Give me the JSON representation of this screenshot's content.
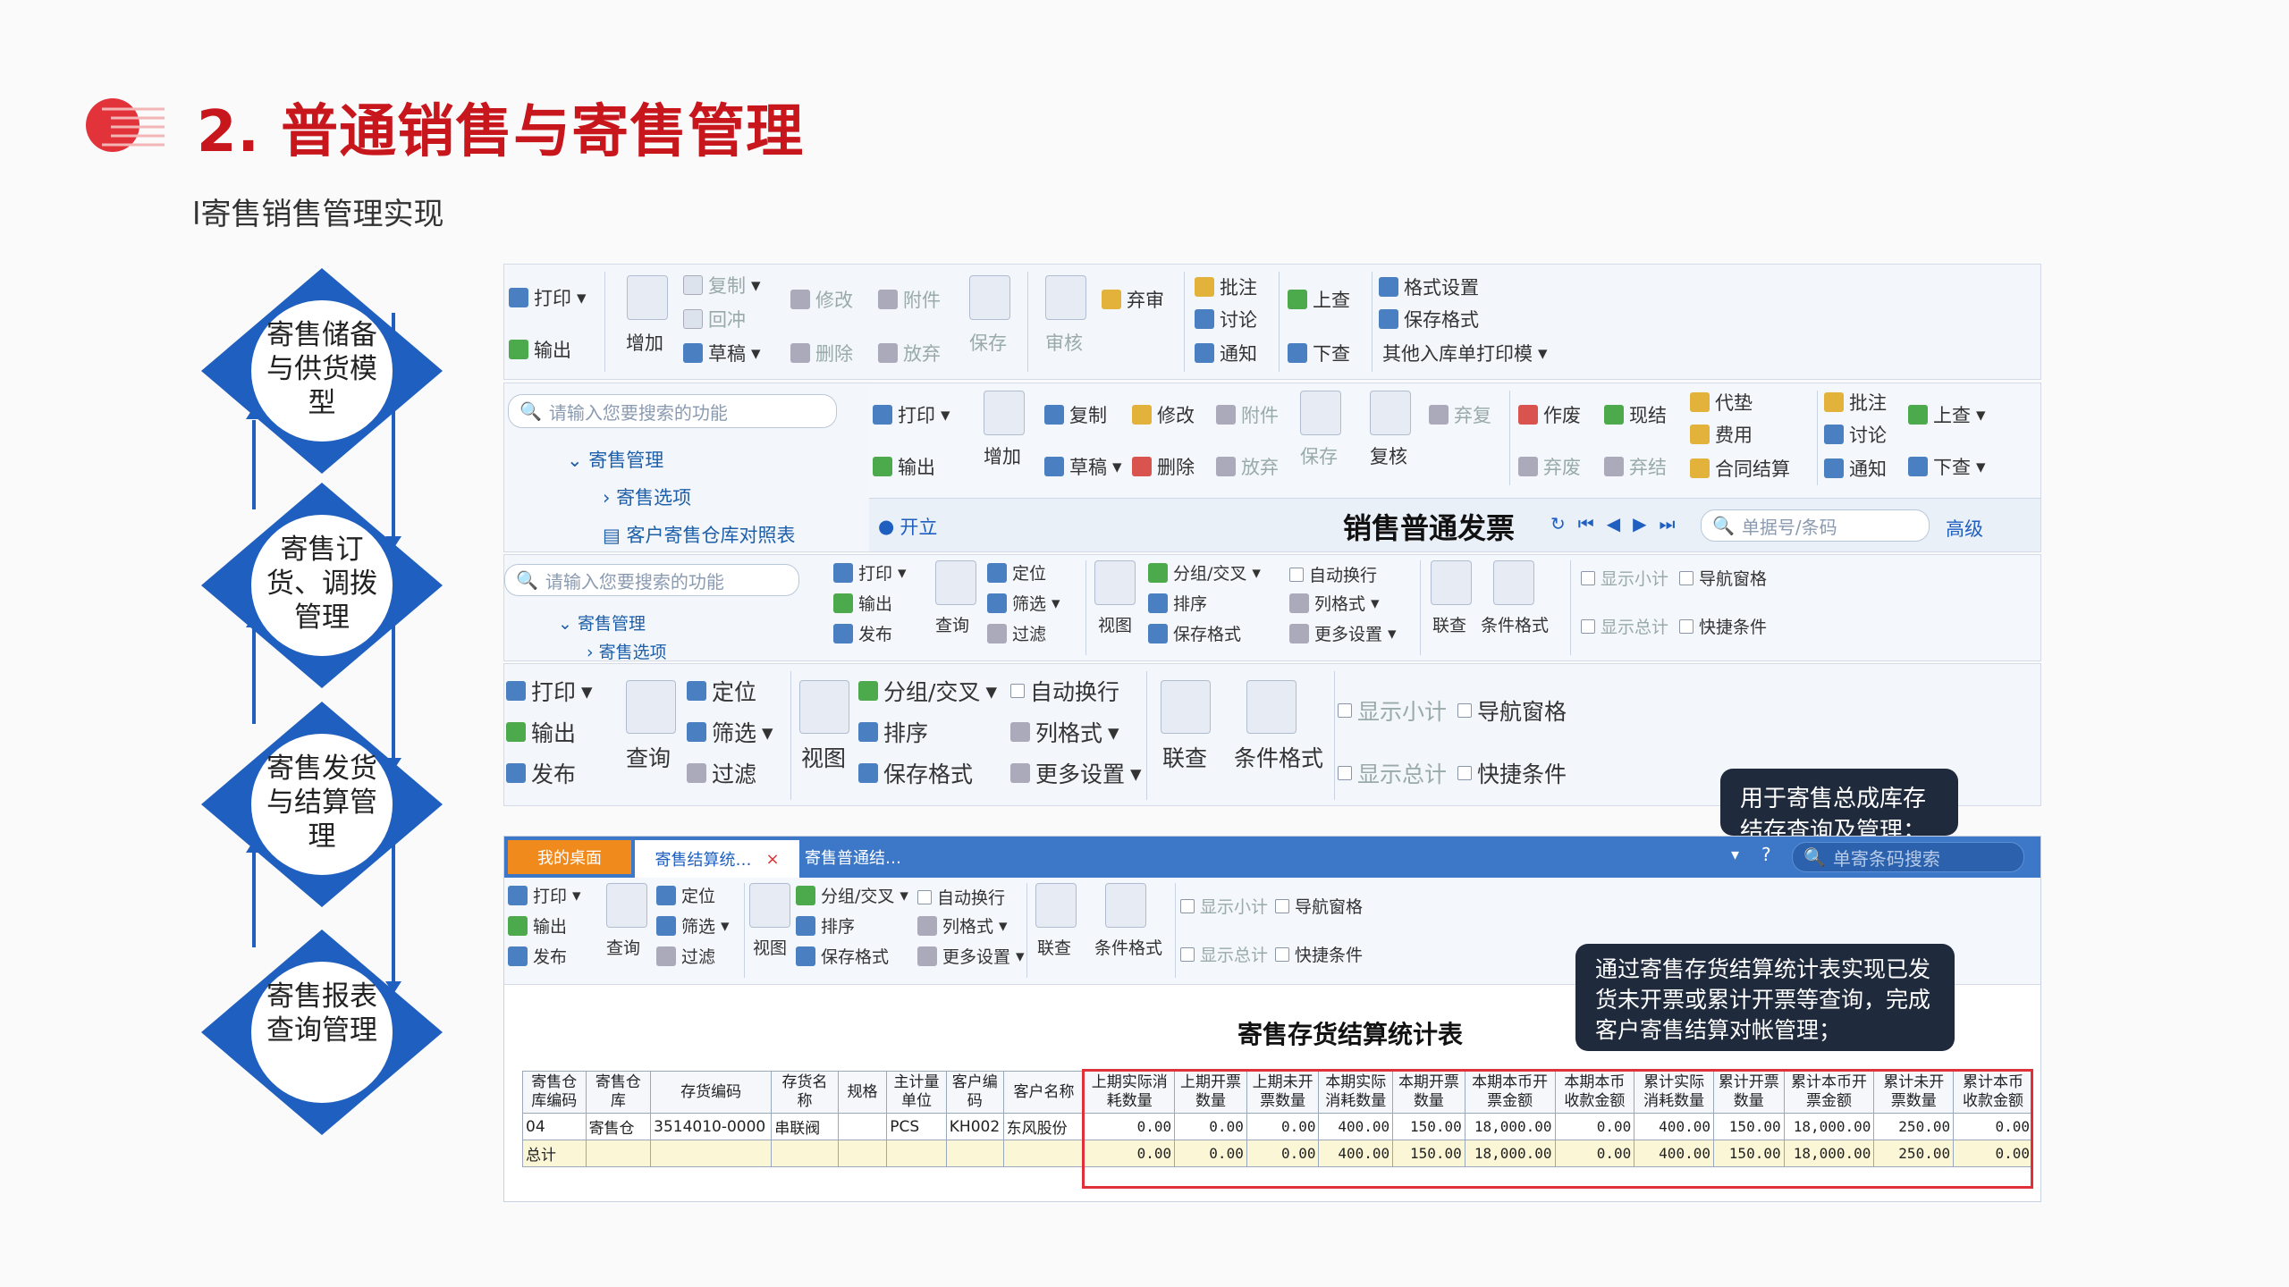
{
  "header": {
    "title": "2. 普通销售与寄售管理",
    "subtitle": "l寄售销售管理实现"
  },
  "flow": [
    {
      "label": "寄售储备与供货模型"
    },
    {
      "label": "寄售订货、调拨管理"
    },
    {
      "label": "寄售发货与结算管理"
    },
    {
      "label": "寄售报表查询管理"
    }
  ],
  "panel1": {
    "print": "打印",
    "export": "输出",
    "add": "增加",
    "copy": "复制",
    "redo": "回冲",
    "draft": "草稿",
    "modify": "修改",
    "delete": "删除",
    "attach": "附件",
    "abandon": "放弃",
    "save": "保存",
    "audit": "审核",
    "unaudit": "弃审",
    "approve": "批注",
    "discuss": "讨论",
    "notify": "通知",
    "prev": "上查",
    "next": "下查",
    "format_set": "格式设置",
    "save_format": "保存格式",
    "other_print": "其他入库单打印模"
  },
  "panel2": {
    "search_placeholder": "请输入您要搜索的功能",
    "tree": [
      "寄售管理",
      "寄售选项",
      "客户寄售仓库对照表"
    ],
    "print": "打印",
    "export": "输出",
    "add": "增加",
    "copy": "复制",
    "draft": "草稿",
    "modify": "修改",
    "delete": "删除",
    "attach": "附件",
    "abandon": "放弃",
    "save": "保存",
    "review": "复核",
    "redo": "弃复",
    "void": "作废",
    "unvoid": "弃废",
    "cash": "现结",
    "cash_undo": "弃结",
    "advance": "代垫",
    "fee": "费用",
    "contract": "合同结算",
    "approve": "批注",
    "discuss": "讨论",
    "notify": "通知",
    "prev": "上查",
    "next": "下查",
    "status": "开立",
    "doc_title": "销售普通发票",
    "search2": "单据号/条码",
    "advanced": "高级"
  },
  "panel3": {
    "search_placeholder": "请输入您要搜索的功能",
    "tree": [
      "寄售管理",
      "寄售选项"
    ],
    "print": "打印",
    "export": "输出",
    "publish": "发布",
    "query": "查询",
    "locate": "定位",
    "filter": "筛选",
    "filter2": "过滤",
    "view": "视图",
    "group": "分组/交叉",
    "sort": "排序",
    "save_format": "保存格式",
    "wrap": "自动换行",
    "col_format": "列格式",
    "more": "更多设置",
    "link": "联查",
    "cond_format": "条件格式",
    "subtotal": "显示小计",
    "total": "显示总计",
    "nav": "导航窗格",
    "quick": "快捷条件"
  },
  "panel4": {
    "print": "打印",
    "export": "输出",
    "publish": "发布",
    "query": "查询",
    "locate": "定位",
    "filter": "筛选",
    "filter2": "过滤",
    "view": "视图",
    "group": "分组/交叉",
    "sort": "排序",
    "save_format": "保存格式",
    "wrap": "自动换行",
    "col_format": "列格式",
    "more": "更多设置",
    "link": "联查",
    "cond_format": "条件格式",
    "subtotal": "显示小计",
    "total": "显示总计",
    "nav": "导航窗格",
    "quick": "快捷条件"
  },
  "callout1": "用于寄售总成库存结存查询及管理；",
  "callout2": "通过寄售存货结算统计表实现已发货未开票或累计开票等查询，完成客户寄售结算对帐管理；",
  "panel5": {
    "tabs": [
      "我的桌面",
      "寄售结算统…",
      "寄售普通结…"
    ],
    "search": "单寄条码搜索",
    "print": "打印",
    "export": "输出",
    "publish": "发布",
    "query": "查询",
    "locate": "定位",
    "filter": "筛选",
    "filter2": "过滤",
    "view": "视图",
    "group": "分组/交叉",
    "sort": "排序",
    "save_format": "保存格式",
    "wrap": "自动换行",
    "col_format": "列格式",
    "more": "更多设置",
    "link": "联查",
    "cond_format": "条件格式",
    "subtotal": "显示小计",
    "total": "显示总计",
    "nav": "导航窗格",
    "quick": "快捷条件",
    "report_title": "寄售存货结算统计表"
  },
  "table": {
    "headers": [
      "寄售仓库编码",
      "寄售仓库",
      "存货编码",
      "存货名称",
      "规格",
      "主计量单位",
      "客户编码",
      "客户名称",
      "上期实际消耗数量",
      "上期开票数量",
      "上期未开票数量",
      "本期实际消耗数量",
      "本期开票数量",
      "本期本币开票金额",
      "本期本币收款金额",
      "累计实际消耗数量",
      "累计开票数量",
      "累计本币开票金额",
      "累计未开票数量",
      "累计本币收款金额"
    ],
    "rows": [
      [
        "04",
        "寄售仓",
        "3514010-0000",
        "串联阀",
        "",
        "PCS",
        "KH002",
        "东风股份",
        "0.00",
        "0.00",
        "0.00",
        "400.00",
        "150.00",
        "18,000.00",
        "0.00",
        "400.00",
        "150.00",
        "18,000.00",
        "250.00",
        "0.00"
      ]
    ],
    "total": [
      "总计",
      "",
      "",
      "",
      "",
      "",
      "",
      "",
      "0.00",
      "0.00",
      "0.00",
      "400.00",
      "150.00",
      "18,000.00",
      "0.00",
      "400.00",
      "150.00",
      "18,000.00",
      "250.00",
      "0.00"
    ]
  }
}
